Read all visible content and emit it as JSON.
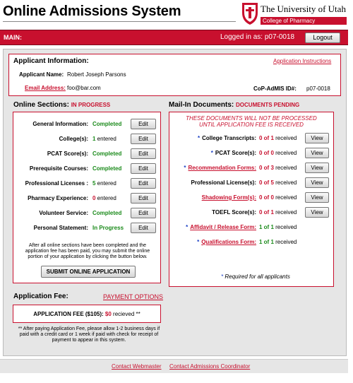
{
  "header": {
    "title": "Online Admissions System",
    "university": "The University of Utah",
    "college": "College of Pharmacy"
  },
  "topbar": {
    "main_label": "MAIN:",
    "logged_in": "Logged in as: p07-0018",
    "logout": "Logout"
  },
  "applicant": {
    "heading": "Applicant Information:",
    "instructions_link": "Application Instructions",
    "name_label": "Applicant Name:",
    "name_value": "Robert Joseph Parsons",
    "email_label": "Email Address:",
    "email_value": "foo@bar.com",
    "id_label": "CoP-AdMIS ID#:",
    "id_value": "p07-0018"
  },
  "online": {
    "heading": "Online Sections:",
    "status": "IN PROGRESS",
    "edit_label": "Edit",
    "rows": [
      {
        "label": "General Information:",
        "value": "Completed"
      },
      {
        "label": "College(s):",
        "num": "1",
        "rest": " entered"
      },
      {
        "label": "PCAT Score(s):",
        "value": "Completed"
      },
      {
        "label": "Prerequisite Courses:",
        "value": "Completed"
      },
      {
        "label": "Professional Licenses :",
        "num": "5",
        "rest": " entered"
      },
      {
        "label": "Pharmacy Experience:",
        "num": "0",
        "rest": " entered"
      },
      {
        "label": "Volunteer Service:",
        "value": "Completed"
      },
      {
        "label": "Personal Statement:",
        "value": "In Progress"
      }
    ],
    "note": "After all online sections have been completed and the application fee has been paid, you may submit the online portion of your application by clicking the button below.",
    "submit": "SUBMIT ONLINE APPLICATION"
  },
  "mail": {
    "heading": "Mail-In Documents:",
    "status": "DOCUMENTS PENDING",
    "warning_1": "THESE DOCUMENTS WILL NOT BE PROCESSED",
    "warning_2": "UNTIL APPLICATION FEE IS RECEIVED",
    "view_label": "View",
    "rows": [
      {
        "star": "*",
        "label": "College Transcripts:",
        "count": "0 of 1",
        "rest": " received"
      },
      {
        "star": "*",
        "label": "PCAT Score(s):",
        "count": "0 of 0",
        "rest": " received"
      },
      {
        "star": "*",
        "label": "Recommendation Forms:",
        "count": "0 of 3",
        "rest": " received"
      },
      {
        "star": "",
        "label": "Professional License(s):",
        "count": "0 of 5",
        "rest": " received"
      },
      {
        "star": "",
        "label": "Shadowing Form(s):",
        "count": "0 of 0",
        "rest": " received"
      },
      {
        "star": "",
        "label": "TOEFL Score(s):",
        "count": "0 of 1",
        "rest": " received"
      },
      {
        "star": "*",
        "label": "Affidavit / Release Form:",
        "count": "1 of 1",
        "rest": " received"
      },
      {
        "star": "*",
        "label": "Qualifications Form:",
        "count": "1 of 1",
        "rest": " received"
      }
    ],
    "footnote_star": "*",
    "footnote": " Required for all applicants"
  },
  "fee": {
    "heading": "Application Fee:",
    "options_link": "PAYMENT OPTIONS",
    "label": "APPLICATION FEE ($105):",
    "amount": "$0",
    "received": " recieved **",
    "note": "** After paying Application Fee, please allow 1-2 business days if paid with a credit card or 1 week if paid with check for receipt of payment to appear in this system."
  },
  "footer": {
    "webmaster": "Contact Webmaster",
    "coordinator": "Contact Admissions Coordinator"
  },
  "colors": {
    "brand_red": "#c8102e",
    "complete_green": "#1a8a1a",
    "star_blue": "#1b3fc4"
  }
}
